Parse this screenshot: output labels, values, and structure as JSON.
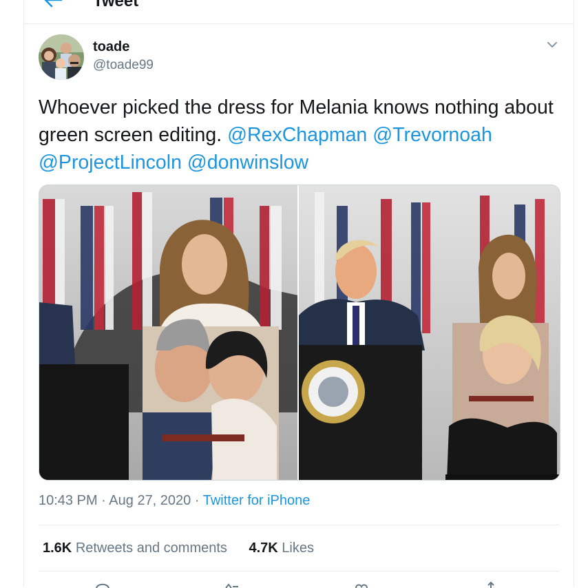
{
  "header": {
    "title": "Tweet"
  },
  "tweet": {
    "author_name": "toade",
    "author_handle": "@toade99",
    "text_plain": "Whoever picked the dress for Melania knows nothing about green screen editing.",
    "mentions": [
      "@RexChapman",
      "@Trevornoah",
      "@ProjectLincoln",
      "@donwinslow"
    ],
    "time": "10:43 PM",
    "date": "Aug 27, 2020",
    "source": "Twitter for iPhone",
    "separator": "·",
    "retweets_count": "1.6K",
    "retweets_label": "Retweets and comments",
    "likes_count": "4.7K",
    "likes_label": "Likes"
  },
  "icons": {
    "back": "arrow-left-icon",
    "more": "chevron-down-icon",
    "actions": [
      "reply-icon",
      "retweet-icon",
      "like-icon",
      "share-icon"
    ]
  },
  "colors": {
    "link": "#1b95e0",
    "secondary_text": "#657786",
    "border": "#e6ecf0"
  }
}
